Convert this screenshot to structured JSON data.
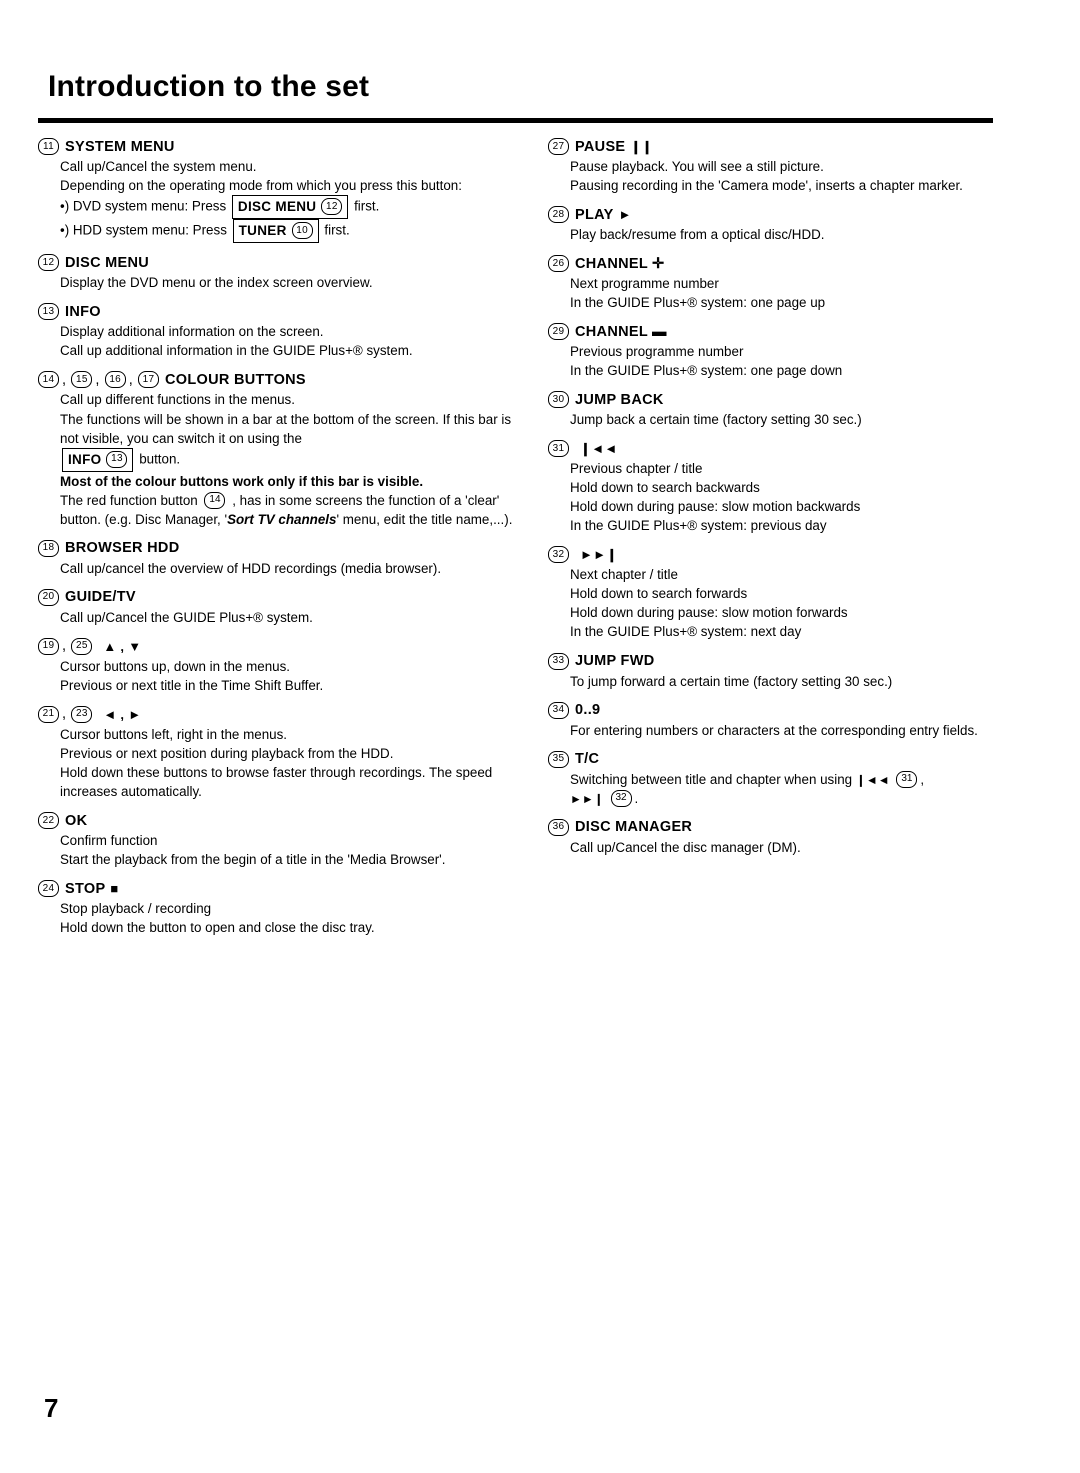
{
  "page": {
    "title": "Introduction to the set",
    "number": "7"
  },
  "left_column": [
    {
      "num": "11",
      "label": "SYSTEM MENU",
      "lines": [
        "Call up/Cancel the system menu.",
        "Depending on the operating mode from which you press this button:"
      ],
      "bullets": [
        {
          "prefix": "•) DVD system menu: Press",
          "key": "DISC MENU",
          "keynum": "12",
          "suffix": "first."
        },
        {
          "prefix": "•) HDD system menu: Press",
          "key": "TUNER",
          "keynum": "10",
          "suffix": "first."
        }
      ]
    },
    {
      "num": "12",
      "label": "DISC MENU",
      "lines": [
        "Display the DVD menu or the index screen overview."
      ]
    },
    {
      "num": "13",
      "label": "INFO",
      "lines": [
        "Display additional information on the screen.",
        "Call up additional information in the GUIDE Plus+® system."
      ]
    },
    {
      "nums": [
        "14",
        "15",
        "16",
        "17"
      ],
      "label": "COLOUR BUTTONS",
      "lines": [
        "Call up different functions in the menus.",
        "The functions will be shown in a bar at the bottom of the screen. If this bar is not visible, you can switch it on using the"
      ],
      "info_line": {
        "key": "INFO",
        "keynum": "13",
        "suffix": "button."
      },
      "bold_line": "Most of the colour buttons work only if this bar is visible.",
      "red_line_a": "The red function button",
      "red_line_b": ", has in some screens the function of a 'clear' button. (e.g. Disc Manager, '",
      "red_italic": "Sort TV channels",
      "red_line_c": "' menu, edit the title name,...)."
    },
    {
      "num": "18",
      "label": "BROWSER HDD",
      "lines": [
        "Call up/cancel the overview of HDD recordings (media browser)."
      ]
    },
    {
      "num": "20",
      "label": "GUIDE/TV",
      "lines": [
        "Call up/Cancel the GUIDE Plus+® system."
      ]
    },
    {
      "nums": [
        "19",
        "25"
      ],
      "glyphs": "▲ , ▼",
      "lines": [
        "Cursor buttons up, down in the menus.",
        "Previous or next title in the Time Shift Buffer."
      ]
    },
    {
      "nums": [
        "21",
        "23"
      ],
      "glyphs": "◄ , ►",
      "lines": [
        "Cursor buttons left, right in the menus.",
        "Previous or next position during playback from the HDD.",
        "Hold down these buttons to browse faster through recordings. The speed increases automatically."
      ]
    },
    {
      "num": "22",
      "label": "OK",
      "lines": [
        "Confirm function",
        "Start the playback from the begin of a title in the 'Media Browser'."
      ]
    },
    {
      "num": "24",
      "label": "STOP",
      "glyphs": "■",
      "lines": [
        "Stop playback / recording",
        "Hold down the button to open and close the disc tray."
      ]
    }
  ],
  "right_column": [
    {
      "num": "27",
      "label": "PAUSE",
      "glyphs": "❙❙",
      "lines": [
        "Pause playback. You will see a still picture.",
        "Pausing recording in the 'Camera mode', inserts a chapter marker."
      ]
    },
    {
      "num": "28",
      "label": "PLAY",
      "glyphs": "►",
      "lines": [
        "Play back/resume from a optical disc/HDD."
      ]
    },
    {
      "num": "26",
      "label": "CHANNEL ✛",
      "lines": [
        "Next programme number",
        "In the GUIDE Plus+® system: one page up"
      ]
    },
    {
      "num": "29",
      "label": "CHANNEL ▬",
      "lines": [
        "Previous programme number",
        "In the GUIDE Plus+® system: one page down"
      ]
    },
    {
      "num": "30",
      "label": "JUMP BACK",
      "lines": [
        "Jump back a certain time (factory setting 30 sec.)"
      ]
    },
    {
      "num": "31",
      "label": "",
      "glyphs": "❙◄◄",
      "lines": [
        "Previous chapter / title",
        "Hold down to search backwards",
        "Hold down during pause: slow motion backwards",
        "In the GUIDE Plus+® system: previous day"
      ]
    },
    {
      "num": "32",
      "label": "",
      "glyphs": "►►❙",
      "lines": [
        "Next chapter / title",
        "Hold down to search forwards",
        "Hold down during pause: slow motion forwards",
        "In the GUIDE Plus+® system: next day"
      ]
    },
    {
      "num": "33",
      "label": "JUMP FWD",
      "lines": [
        "To jump forward a certain time (factory setting 30 sec.)"
      ]
    },
    {
      "num": "34",
      "label": "0..9",
      "lines": [
        "For entering numbers or characters at the corresponding entry fields."
      ]
    },
    {
      "num": "35",
      "label": "T/C",
      "tc_line_a": "Switching between title and chapter when using",
      "tc_glyph_1": "❙◄◄",
      "tc_num_1": "31",
      "tc_comma": ",",
      "tc_glyph_2": "►►❙",
      "tc_num_2": "32",
      "tc_period": "."
    },
    {
      "num": "36",
      "label": "DISC MANAGER",
      "lines": [
        "Call up/Cancel the disc manager (DM)."
      ]
    }
  ]
}
